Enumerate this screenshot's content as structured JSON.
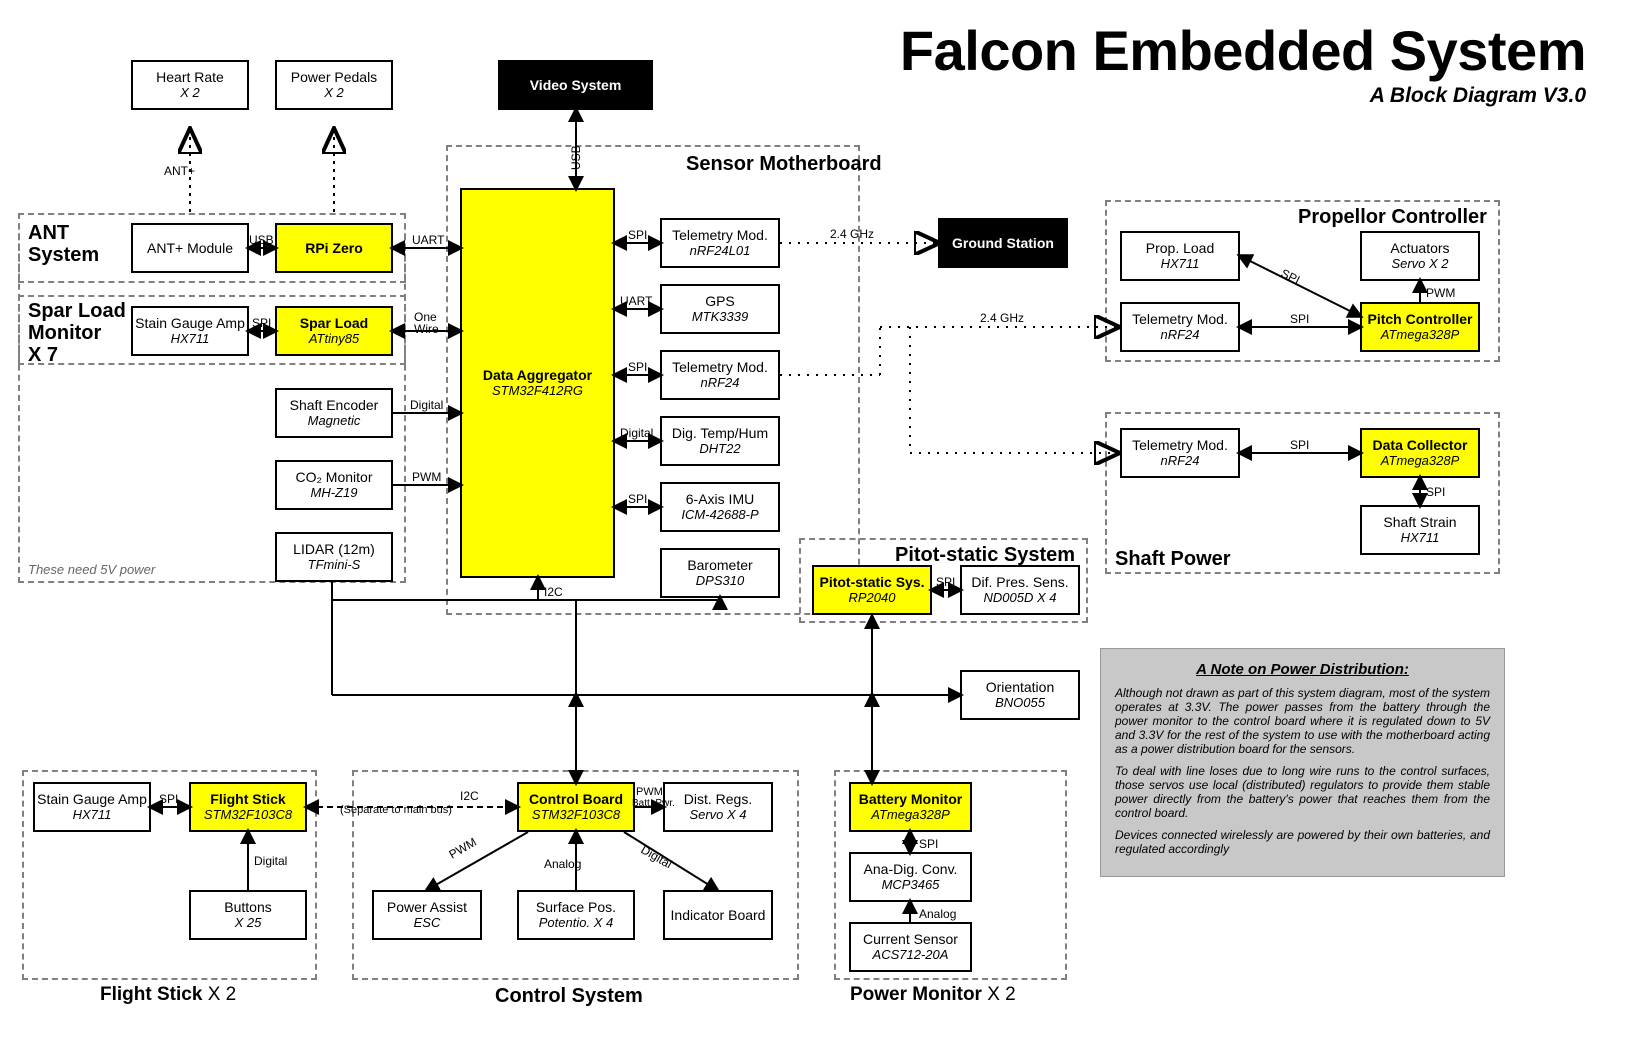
{
  "title": "Falcon Embedded System",
  "subtitle": "A Block Diagram V3.0",
  "blocks": {
    "heartRate": {
      "t": "Heart Rate",
      "s": "X 2"
    },
    "powerPedals": {
      "t": "Power Pedals",
      "s": "X 2"
    },
    "videoSystem": {
      "t": "Video System"
    },
    "antModule": {
      "t": "ANT+ Module"
    },
    "rpiZero": {
      "t": "RPi Zero"
    },
    "stainGauge1": {
      "t": "Stain Gauge Amp",
      "s": "HX711"
    },
    "sparLoad": {
      "t": "Spar Load",
      "s": "ATtiny85"
    },
    "shaftEncoder": {
      "t": "Shaft Encoder",
      "s": "Magnetic"
    },
    "co2": {
      "t": "CO₂ Monitor",
      "s": "MH-Z19"
    },
    "lidar": {
      "t": "LIDAR (12m)",
      "s": "TFmini-S"
    },
    "dataAgg": {
      "t": "Data Aggregator",
      "s": "STM32F412RG"
    },
    "telem1": {
      "t": "Telemetry Mod.",
      "s": "nRF24L01"
    },
    "gps": {
      "t": "GPS",
      "s": "MTK3339"
    },
    "telem2": {
      "t": "Telemetry Mod.",
      "s": "nRF24"
    },
    "digTemp": {
      "t": "Dig. Temp/Hum",
      "s": "DHT22"
    },
    "imu": {
      "t": "6-Axis IMU",
      "s": "ICM-42688-P"
    },
    "baro": {
      "t": "Barometer",
      "s": "DPS310"
    },
    "groundStation": {
      "t": "Ground Station"
    },
    "propLoad": {
      "t": "Prop. Load",
      "s": "HX711"
    },
    "actuators": {
      "t": "Actuators",
      "s": "Servo X 2"
    },
    "telem3": {
      "t": "Telemetry Mod.",
      "s": "nRF24"
    },
    "pitchCtrl": {
      "t": "Pitch Controller",
      "s": "ATmega328P"
    },
    "telem4": {
      "t": "Telemetry Mod.",
      "s": "nRF24"
    },
    "dataColl": {
      "t": "Data Collector",
      "s": "ATmega328P"
    },
    "shaftStrain": {
      "t": "Shaft Strain",
      "s": "HX711"
    },
    "pitotSys": {
      "t": "Pitot-static Sys.",
      "s": "RP2040"
    },
    "difPres": {
      "t": "Dif. Pres. Sens.",
      "s": "ND005D X 4"
    },
    "orientation": {
      "t": "Orientation",
      "s": "BNO055"
    },
    "stainGauge2": {
      "t": "Stain Gauge Amp",
      "s": "HX711"
    },
    "flightStick": {
      "t": "Flight Stick",
      "s": "STM32F103C8"
    },
    "buttons": {
      "t": "Buttons",
      "s": "X 25"
    },
    "powerAssist": {
      "t": "Power Assist",
      "s": "ESC"
    },
    "controlBoard": {
      "t": "Control Board",
      "s": "STM32F103C8"
    },
    "surfacePos": {
      "t": "Surface Pos.",
      "s": "Potentio. X 4"
    },
    "distRegs": {
      "t": "Dist. Regs.",
      "s": "Servo X 4"
    },
    "indicatorBoard": {
      "t": "Indicator Board"
    },
    "battMon": {
      "t": "Battery Monitor",
      "s": "ATmega328P"
    },
    "anaDig": {
      "t": "Ana-Dig. Conv.",
      "s": "MCP3465"
    },
    "currentSensor": {
      "t": "Current Sensor",
      "s": "ACS712-20A"
    }
  },
  "groups": {
    "ant": "ANT\nSystem",
    "sparLoadMon": "Spar Load\nMonitor\nX 7",
    "sensorMB": "Sensor Motherboard",
    "propCtrl": "Propellor Controller",
    "shaftPower": "Shaft Power",
    "pitotStatic": "Pitot-static System",
    "flightStick": "Flight Stick X 2",
    "controlSys": "Control System",
    "powerMon": "Power Monitor X 2"
  },
  "labels": {
    "antPlus": "ANT+",
    "usb": "USB",
    "usb2": "USB",
    "uart": "UART",
    "oneWire": "One\nWire",
    "digital": "Digital",
    "pwm": "PWM",
    "spi": "SPI",
    "uart2": "UART",
    "i2c": "I2C",
    "24ghz": "2.4 GHz",
    "24ghz2": "2.4 GHz",
    "i2cSep": "I2C\n(Separate to main bus)",
    "analog": "Analog",
    "pwmBatt": "PWM\nBatt. Pwr.",
    "need5v": "These need 5V power"
  },
  "note": {
    "title": "A Note on Power Distribution:",
    "p1": "Although not drawn as part of this system diagram, most of the system operates at 3.3V. The power passes from the battery through the power monitor to the control board where it is regulated down to 5V and 3.3V for the rest of the system to use with the motherboard acting as a power distribution board for the sensors.",
    "p2": "To deal with line loses due to long wire runs to the control surfaces, those servos use local (distributed) regulators to provide them stable power directly from the battery's power that reaches them from the control board.",
    "p3": "Devices connected wirelessly are powered by their own batteries, and regulated accordingly"
  }
}
